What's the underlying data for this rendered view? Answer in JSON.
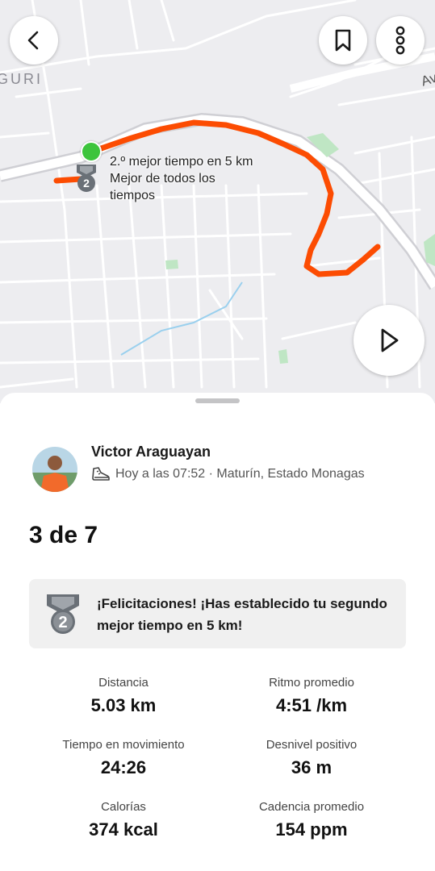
{
  "colors": {
    "accent": "#fc4c02",
    "start_dot": "#3cc43c",
    "map_bg": "#ededf0",
    "banner_bg": "#f0f0f0"
  },
  "map": {
    "personal_record_label_line1": "2.º mejor tiempo en 5 km",
    "personal_record_label_line2": "Mejor de todos los",
    "personal_record_label_line3": "tiempos",
    "medal_number": "2",
    "map_text_fragment": "GURI",
    "map_text_fragment_right": "Av"
  },
  "toolbar": {
    "back_icon": "chevron-left-icon",
    "bookmark_icon": "bookmark-icon",
    "more_icon": "more-vertical-icon",
    "play_icon": "play-icon"
  },
  "activity": {
    "athlete_name": "Victor Araguayan",
    "sport_icon": "running-shoe-icon",
    "when_where": "Hoy a las 07:52 · Maturín, Estado Monagas",
    "achievement_count": "3 de 7",
    "banner_text": "¡Felicitaciones! ¡Has establecido tu segundo mejor tiempo en 5 km!",
    "banner_medal_number": "2"
  },
  "stats": [
    {
      "label": "Distancia",
      "value": "5.03 km"
    },
    {
      "label": "Ritmo promedio",
      "value": "4:51 /km"
    },
    {
      "label": "Tiempo en movimiento",
      "value": "24:26"
    },
    {
      "label": "Desnivel positivo",
      "value": "36 m"
    },
    {
      "label": "Calorías",
      "value": "374 kcal"
    },
    {
      "label": "Cadencia promedio",
      "value": "154 ppm"
    }
  ]
}
